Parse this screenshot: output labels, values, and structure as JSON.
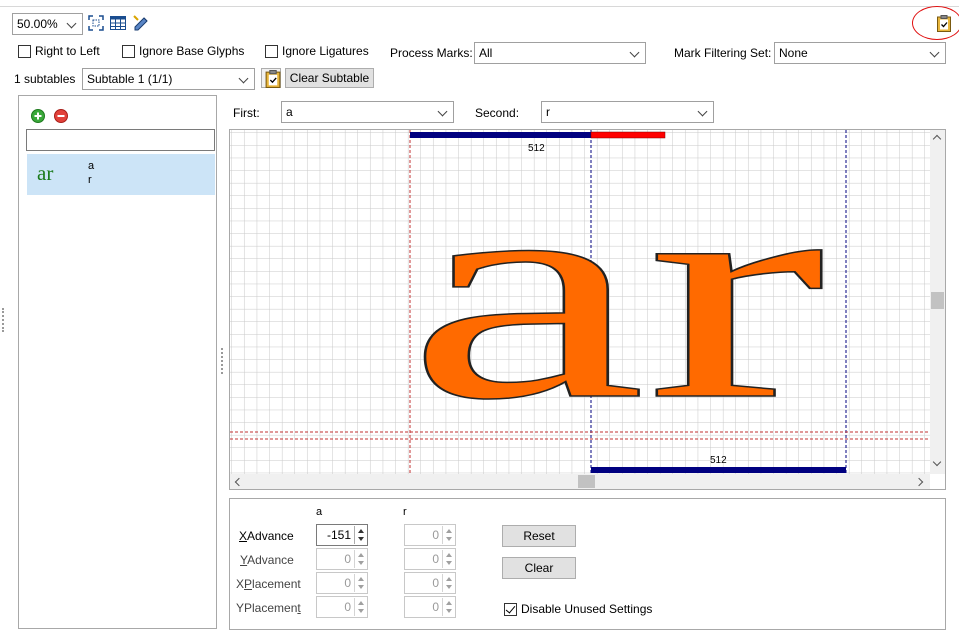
{
  "toolbar": {
    "zoom": "50.00%",
    "icons": [
      "fit-view-icon",
      "table-icon",
      "edit-pencil-icon",
      "clipboard-icon"
    ]
  },
  "options": {
    "right_to_left": {
      "label": "Right to Left",
      "checked": false
    },
    "ignore_base_glyphs": {
      "label": "Ignore Base Glyphs",
      "checked": false
    },
    "ignore_ligatures": {
      "label": "Ignore Ligatures",
      "checked": false
    },
    "process_marks_label": "Process Marks:",
    "process_marks_value": "All",
    "mark_filtering_label": "Mark Filtering Set:",
    "mark_filtering_value": "None"
  },
  "subtables": {
    "count_label": "1 subtables",
    "selected": "Subtable 1 (1/1)",
    "clear_button": "Clear Subtable"
  },
  "pair_list": {
    "search_value": "",
    "items": [
      {
        "preview": "ar",
        "first": "a",
        "second": "r"
      }
    ]
  },
  "pair_selector": {
    "first_label": "First:",
    "first_value": "a",
    "second_label": "Second:",
    "second_value": "r"
  },
  "preview": {
    "text": "ar",
    "first_advance_label": "512",
    "second_advance_label": "512",
    "colors": {
      "glyph": "#ff6a00",
      "advance_bar": "#000080",
      "kern_bar": "#ff0000",
      "grid": "#c8c8c8"
    }
  },
  "values": {
    "col_first": "a",
    "col_second": "r",
    "rows": [
      {
        "label": "XAdvance",
        "first": "-151",
        "second": "0"
      },
      {
        "label": "YAdvance",
        "first": "0",
        "second": "0"
      },
      {
        "label": "XPlacement",
        "first": "0",
        "second": "0"
      },
      {
        "label": "YPlacement",
        "first": "0",
        "second": "0"
      }
    ],
    "reset_button": "Reset",
    "clear_button": "Clear",
    "disable_unused": {
      "label": "Disable Unused Settings",
      "checked": true
    }
  }
}
